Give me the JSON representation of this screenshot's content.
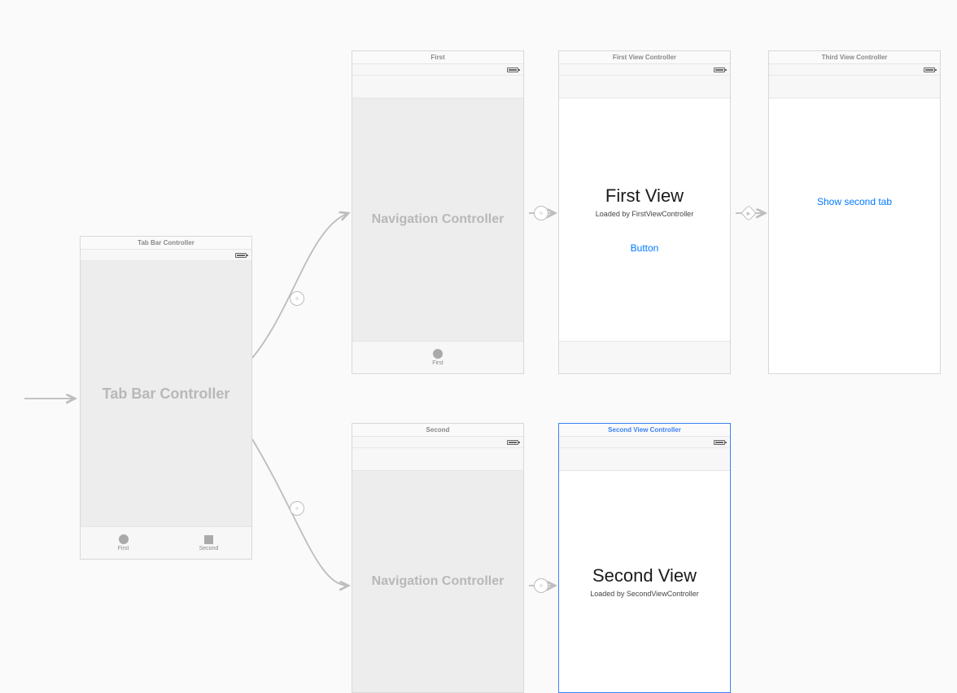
{
  "tabbar_scene": {
    "header": "Tab Bar Controller",
    "body_title": "Tab Bar Controller",
    "tabs": [
      {
        "label": "First"
      },
      {
        "label": "Second"
      }
    ]
  },
  "nav_first": {
    "header": "First",
    "body_title": "Navigation Controller",
    "tab_label": "First"
  },
  "nav_second": {
    "header": "Second",
    "body_title": "Navigation Controller"
  },
  "first_vc": {
    "header": "First View Controller",
    "title": "First View",
    "subtitle": "Loaded by FirstViewController",
    "button": "Button"
  },
  "second_vc": {
    "header": "Second View Controller",
    "title": "Second View",
    "subtitle": "Loaded by SecondViewController"
  },
  "third_vc": {
    "header": "Third View Controller",
    "button": "Show second tab"
  }
}
